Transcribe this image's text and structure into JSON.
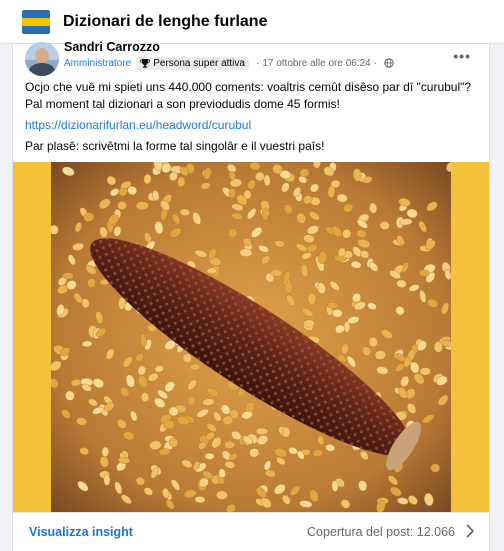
{
  "group": {
    "title": "Dizionari de lenghe furlane",
    "logo_icon": "friulian-flag-icon"
  },
  "post": {
    "author": "Sandri Carrozzo",
    "role": "Amministratore",
    "badge": "Persona super attiva",
    "separator": "·",
    "timestamp": "17 ottobre alle ore 06:24",
    "privacy_icon": "globe-icon",
    "more_icon": "more-options-icon",
    "text_line1": "Ocjo che vuê mi spieti uns 440.000 coments: voaltris cemût disêso par dî \"curubul\"?",
    "text_line2": "Pal moment tal dizionari a son previodudis dome 45 formis!",
    "link": "https://dizionarifurlan.eu/headword/curubul",
    "text_line3": "Par plasê: scrivêtmi la forme tal singolâr e il vuestri paîs!",
    "image_icon": "corn-cob-photo"
  },
  "footer": {
    "insight_label": "Visualizza insight",
    "reach_label": "Copertura del post: 12.066"
  },
  "colors": {
    "accent": "#1877f2",
    "link": "#1b74e4",
    "photo_border": "#f3c23a"
  }
}
